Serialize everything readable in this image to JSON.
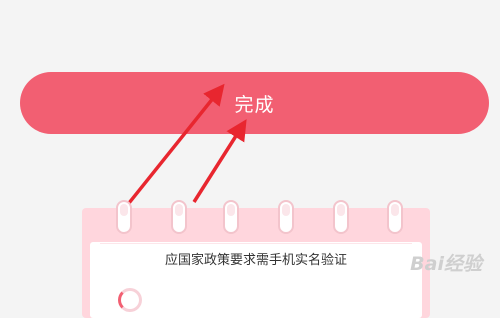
{
  "done_button": {
    "label": "完成"
  },
  "calendar": {
    "text": "应国家政策要求需手机实名验证"
  },
  "watermark": {
    "text": "Bai经验"
  },
  "colors": {
    "accent": "#f25f72",
    "arrow": "#e8262f",
    "card": "#ffd6dd",
    "background": "#f4f4f4"
  }
}
